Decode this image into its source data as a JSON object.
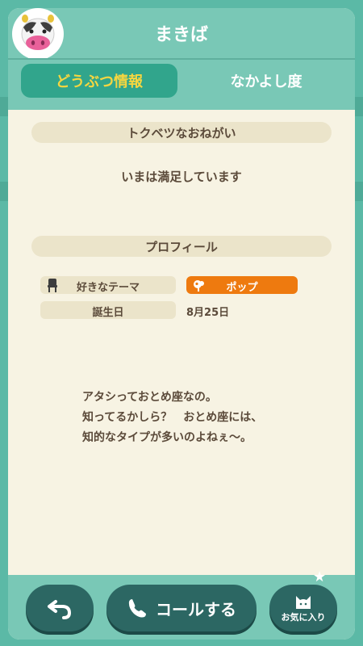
{
  "villager": {
    "name": "まきば"
  },
  "tabs": [
    {
      "label": "どうぶつ情報",
      "active": true
    },
    {
      "label": "なかよし度",
      "active": false
    }
  ],
  "special_request": {
    "heading": "トクベツなおねがい",
    "text": "いまは満足しています"
  },
  "profile": {
    "heading": "プロフィール",
    "favorite_theme_label": "好きなテーマ",
    "favorite_theme_value": "ポップ",
    "birthday_label": "誕生日",
    "birthday_value": "8月25日"
  },
  "quote": {
    "line1": "アタシっておとめ座なの。",
    "line2": "知ってるかしら？　おとめ座には、",
    "line3": "知的なタイプが多いのよねぇ〜。"
  },
  "footer": {
    "call_label": "コールする",
    "favorite_label": "お気に入り"
  },
  "icons": {
    "avatar": "cow-villager-avatar",
    "theme": "chair-icon",
    "pop": "lamp-icon",
    "back": "back-arrow-icon",
    "call": "phone-icon",
    "favorite": "cat-icon",
    "favorite_badge": "star-icon"
  },
  "colors": {
    "header": "#79c8b6",
    "active_tab": "#31a58c",
    "active_tab_text": "#f6d640",
    "panel": "#f7f3e3",
    "section_bar": "#ebe4ca",
    "pop_pill": "#ee7a0f",
    "footer_button": "#2c6763",
    "text": "#5b4a3a"
  }
}
